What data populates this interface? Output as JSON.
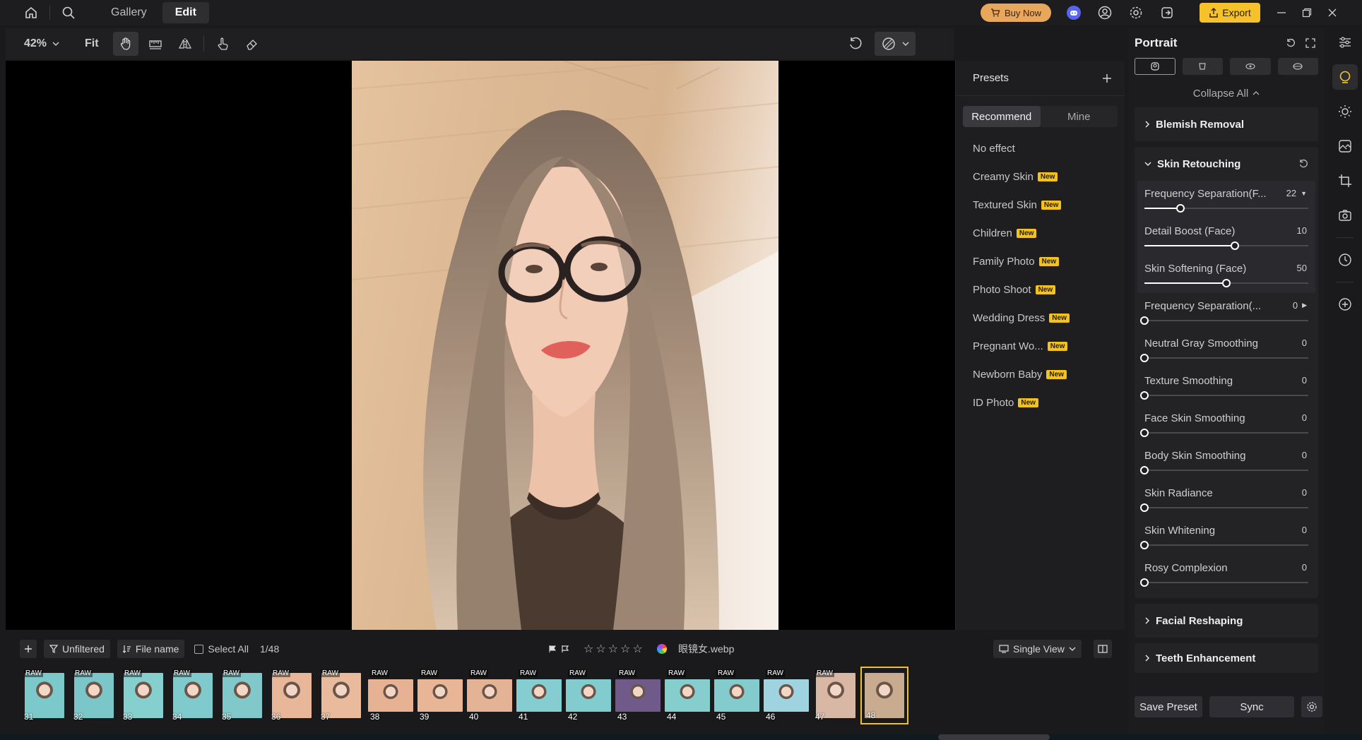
{
  "topbar": {
    "tabs": [
      {
        "label": "Gallery",
        "active": false
      },
      {
        "label": "Edit",
        "active": true
      }
    ],
    "buy_now": "Buy Now",
    "export": "Export",
    "icons": [
      "home-icon",
      "search-icon",
      "discord-icon",
      "account-icon",
      "settings-icon",
      "login-icon"
    ]
  },
  "toolbar": {
    "zoom": "42%",
    "fit": "Fit",
    "tools": [
      "hand-icon",
      "straighten-icon",
      "flip-icon",
      "touch-icon",
      "eraser-icon"
    ],
    "right": [
      "reset-icon",
      "compare-icon"
    ]
  },
  "presets": {
    "title": "Presets",
    "tabs": [
      {
        "label": "Recommend",
        "active": true
      },
      {
        "label": "Mine",
        "active": false
      }
    ],
    "new_badge": "New",
    "items": [
      {
        "label": "No effect",
        "new": false
      },
      {
        "label": "Creamy Skin",
        "new": true
      },
      {
        "label": "Textured Skin",
        "new": true
      },
      {
        "label": "Children",
        "new": true
      },
      {
        "label": "Family Photo",
        "new": true
      },
      {
        "label": "Photo Shoot",
        "new": true
      },
      {
        "label": "Wedding Dress",
        "new": true
      },
      {
        "label": "Pregnant Wo...",
        "new": true
      },
      {
        "label": "Newborn Baby",
        "new": true
      },
      {
        "label": "ID Photo",
        "new": true
      }
    ]
  },
  "adjust": {
    "title": "Portrait",
    "collapse_all": "Collapse All",
    "sections": {
      "blemish": "Blemish Removal",
      "skin": "Skin Retouching",
      "facial": "Facial Reshaping",
      "teeth": "Teeth Enhancement"
    },
    "sliders_group": [
      {
        "label": "Frequency Separation(F...",
        "value": "22",
        "pct": 0.22
      },
      {
        "label": "Detail Boost (Face)",
        "value": "10",
        "pct": 0.55
      },
      {
        "label": "Skin Softening (Face)",
        "value": "50",
        "pct": 0.5
      }
    ],
    "sliders": [
      {
        "label": "Frequency Separation(...",
        "value": "0",
        "pct": 0
      },
      {
        "label": "Neutral Gray Smoothing",
        "value": "0",
        "pct": 0
      },
      {
        "label": "Texture Smoothing",
        "value": "0",
        "pct": 0
      },
      {
        "label": "Face Skin Smoothing",
        "value": "0",
        "pct": 0
      },
      {
        "label": "Body Skin Smoothing",
        "value": "0",
        "pct": 0
      },
      {
        "label": "Skin Radiance",
        "value": "0",
        "pct": 0
      },
      {
        "label": "Skin Whitening",
        "value": "0",
        "pct": 0
      },
      {
        "label": "Rosy Complexion",
        "value": "0",
        "pct": 0
      }
    ],
    "save_preset": "Save Preset",
    "sync": "Sync"
  },
  "filmbar": {
    "unfiltered": "Unfiltered",
    "file_name": "File name",
    "select_all": "Select All",
    "count": "1/48",
    "filename": "眼镜女.webp",
    "view": "Single View"
  },
  "film": [
    {
      "num": "31",
      "raw": "RAW",
      "bg": "#7cc9cc"
    },
    {
      "num": "32",
      "raw": "RAW",
      "bg": "#7ac6c9"
    },
    {
      "num": "33",
      "raw": "RAW",
      "bg": "#85cfcf"
    },
    {
      "num": "34",
      "raw": "RAW",
      "bg": "#7fcacd"
    },
    {
      "num": "35",
      "raw": "RAW",
      "bg": "#80c8c9"
    },
    {
      "num": "36",
      "raw": "RAW",
      "bg": "#e8b79a"
    },
    {
      "num": "37",
      "raw": "RAW",
      "bg": "#e9ba9c"
    },
    {
      "num": "38",
      "raw": "RAW",
      "bg": "#e6b293"
    },
    {
      "num": "39",
      "raw": "RAW",
      "bg": "#e8b596"
    },
    {
      "num": "40",
      "raw": "RAW",
      "bg": "#e4b395"
    },
    {
      "num": "41",
      "raw": "RAW",
      "bg": "#85cdd0"
    },
    {
      "num": "42",
      "raw": "RAW",
      "bg": "#82cbcf"
    },
    {
      "num": "43",
      "raw": "RAW",
      "bg": "#6f5a8a"
    },
    {
      "num": "44",
      "raw": "RAW",
      "bg": "#86cdcd"
    },
    {
      "num": "45",
      "raw": "RAW",
      "bg": "#83cbcc"
    },
    {
      "num": "46",
      "raw": "RAW",
      "bg": "#9fd3e0"
    },
    {
      "num": "47",
      "raw": "RAW",
      "bg": "#d8b8a5"
    },
    {
      "num": "48",
      "raw": "",
      "bg": "#c9ac90",
      "selected": true
    }
  ]
}
